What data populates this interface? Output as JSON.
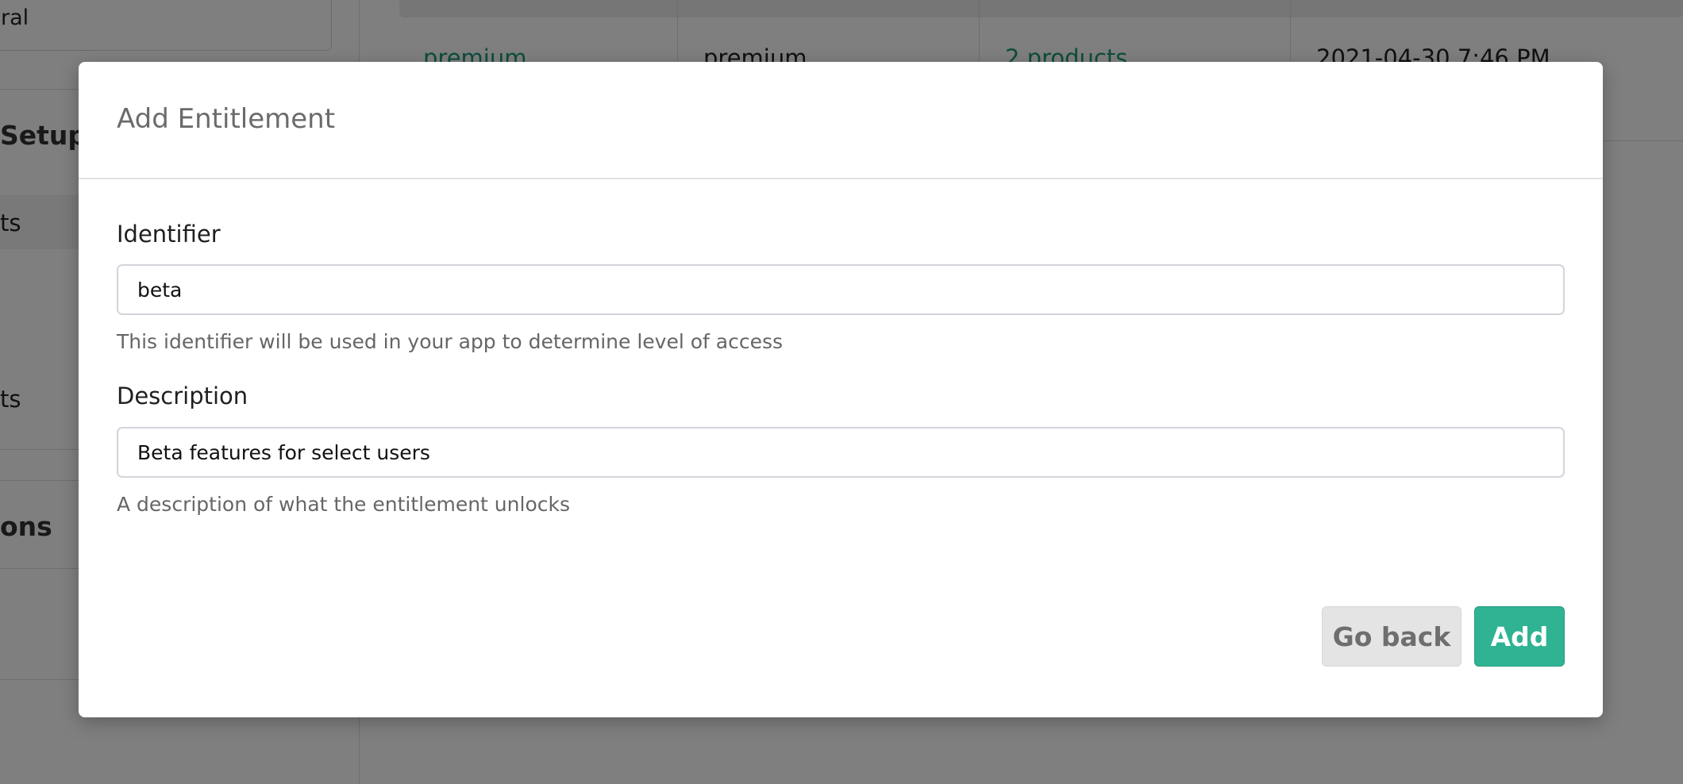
{
  "background": {
    "sidebar": {
      "card_label": "ral",
      "setup_heading": "Setup",
      "item1_label": "ts",
      "item2_label": "ts",
      "section_heading": "ons"
    },
    "table_row": {
      "identifier": "premium",
      "description": "premium",
      "products": "2 products",
      "created": "2021-04-30 7:46 PM"
    }
  },
  "modal": {
    "title": "Add Entitlement",
    "identifier": {
      "label": "Identifier",
      "value": "beta",
      "helper": "This identifier will be used in your app to determine level of access"
    },
    "description": {
      "label": "Description",
      "value": "Beta features for select users",
      "helper": "A description of what the entitlement unlocks"
    },
    "buttons": {
      "back_label": "Go back",
      "add_label": "Add"
    }
  },
  "colors": {
    "accent": "#2fb393",
    "link_green": "#1a9a78",
    "overlay": "rgba(0,0,0,0.5)"
  }
}
